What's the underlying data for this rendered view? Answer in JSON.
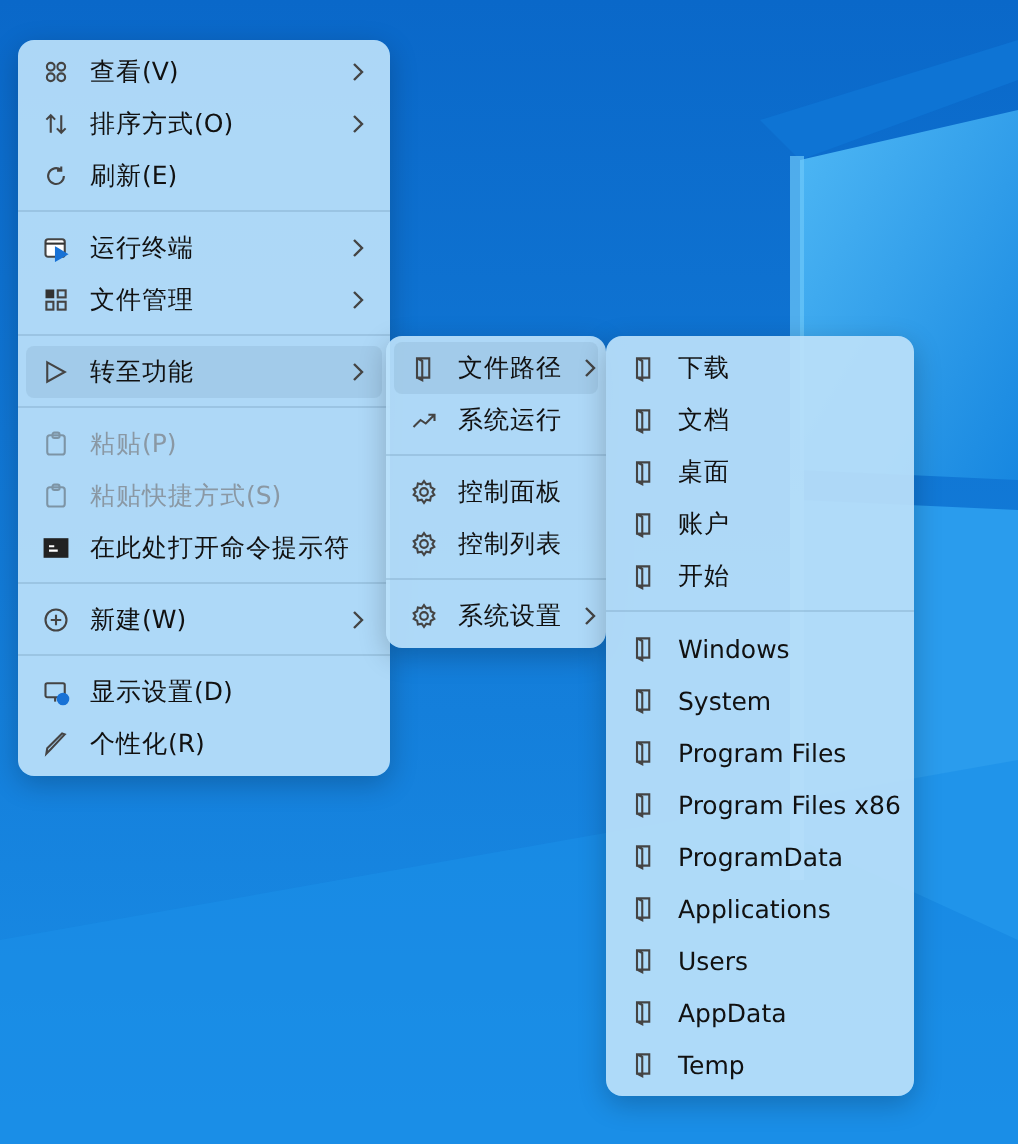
{
  "menus": [
    {
      "groups": [
        [
          {
            "label": "查看(V)",
            "kind": "grid",
            "submenu": true,
            "disabled": false,
            "selected": false
          },
          {
            "label": "排序方式(O)",
            "kind": "sort",
            "submenu": true,
            "disabled": false,
            "selected": false
          },
          {
            "label": "刷新(E)",
            "kind": "refresh",
            "submenu": false,
            "disabled": false,
            "selected": false
          }
        ],
        [
          {
            "label": "运行终端",
            "kind": "terminal",
            "submenu": true,
            "disabled": false,
            "selected": false
          },
          {
            "label": "文件管理",
            "kind": "apps",
            "submenu": true,
            "disabled": false,
            "selected": false
          }
        ],
        [
          {
            "label": "转至功能",
            "kind": "pointer",
            "submenu": true,
            "disabled": false,
            "selected": true
          }
        ],
        [
          {
            "label": "粘贴(P)",
            "kind": "paste",
            "submenu": false,
            "disabled": true,
            "selected": false
          },
          {
            "label": "粘贴快捷方式(S)",
            "kind": "paste",
            "submenu": false,
            "disabled": true,
            "selected": false
          },
          {
            "label": "在此处打开命令提示符",
            "kind": "cmd",
            "submenu": false,
            "disabled": false,
            "selected": false
          }
        ],
        [
          {
            "label": "新建(W)",
            "kind": "plus",
            "submenu": true,
            "disabled": false,
            "selected": false
          }
        ],
        [
          {
            "label": "显示设置(D)",
            "kind": "display",
            "submenu": false,
            "disabled": false,
            "selected": false
          },
          {
            "label": "个性化(R)",
            "kind": "brush",
            "submenu": false,
            "disabled": false,
            "selected": false
          }
        ]
      ]
    },
    {
      "groups": [
        [
          {
            "label": "文件路径",
            "kind": "folder",
            "submenu": true,
            "disabled": false,
            "selected": true
          },
          {
            "label": "系统运行",
            "kind": "trend",
            "submenu": false,
            "disabled": false,
            "selected": false
          }
        ],
        [
          {
            "label": "控制面板",
            "kind": "gear",
            "submenu": false,
            "disabled": false,
            "selected": false
          },
          {
            "label": "控制列表",
            "kind": "gear",
            "submenu": false,
            "disabled": false,
            "selected": false
          }
        ],
        [
          {
            "label": "系统设置",
            "kind": "gear",
            "submenu": true,
            "disabled": false,
            "selected": false
          }
        ]
      ]
    },
    {
      "groups": [
        [
          {
            "label": "下载",
            "kind": "folder",
            "submenu": false,
            "disabled": false,
            "selected": false
          },
          {
            "label": "文档",
            "kind": "folder",
            "submenu": false,
            "disabled": false,
            "selected": false
          },
          {
            "label": "桌面",
            "kind": "folder",
            "submenu": false,
            "disabled": false,
            "selected": false
          },
          {
            "label": "账户",
            "kind": "folder",
            "submenu": false,
            "disabled": false,
            "selected": false
          },
          {
            "label": "开始",
            "kind": "folder",
            "submenu": false,
            "disabled": false,
            "selected": false
          }
        ],
        [
          {
            "label": "Windows",
            "kind": "folder",
            "submenu": false,
            "disabled": false,
            "selected": false
          },
          {
            "label": "System",
            "kind": "folder",
            "submenu": false,
            "disabled": false,
            "selected": false
          },
          {
            "label": "Program Files",
            "kind": "folder",
            "submenu": false,
            "disabled": false,
            "selected": false
          },
          {
            "label": "Program Files x86",
            "kind": "folder",
            "submenu": false,
            "disabled": false,
            "selected": false
          },
          {
            "label": "ProgramData",
            "kind": "folder",
            "submenu": false,
            "disabled": false,
            "selected": false
          },
          {
            "label": "Applications",
            "kind": "folder",
            "submenu": false,
            "disabled": false,
            "selected": false
          },
          {
            "label": "Users",
            "kind": "folder",
            "submenu": false,
            "disabled": false,
            "selected": false
          },
          {
            "label": "AppData",
            "kind": "folder",
            "submenu": false,
            "disabled": false,
            "selected": false
          },
          {
            "label": "Temp",
            "kind": "folder",
            "submenu": false,
            "disabled": false,
            "selected": false
          }
        ]
      ]
    }
  ]
}
